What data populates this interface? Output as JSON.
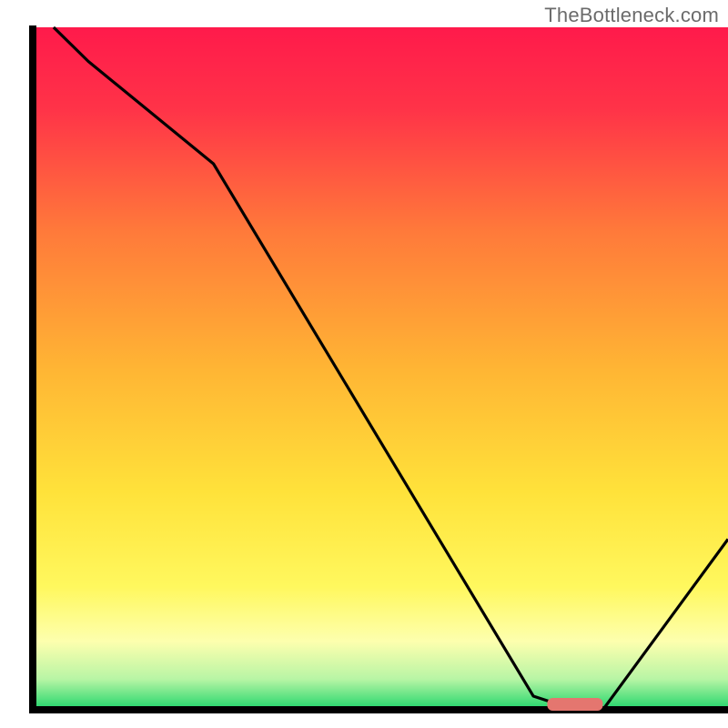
{
  "watermark": "TheBottleneck.com",
  "chart_data": {
    "type": "line",
    "title": "",
    "xlabel": "",
    "ylabel": "",
    "xlim": [
      0,
      100
    ],
    "ylim": [
      0,
      100
    ],
    "series": [
      {
        "name": "bottleneck-curve",
        "x": [
          3,
          8,
          26,
          72,
          78,
          82,
          100
        ],
        "y": [
          100,
          95,
          80,
          2,
          0,
          0,
          25
        ]
      }
    ],
    "marker": {
      "name": "optimal-range",
      "x_start": 74,
      "x_end": 82,
      "y": 0.8,
      "color": "#e4766f"
    },
    "gradient_stops": [
      {
        "offset": 0.0,
        "color": "#ff1a4b"
      },
      {
        "offset": 0.12,
        "color": "#ff3348"
      },
      {
        "offset": 0.3,
        "color": "#ff7a3a"
      },
      {
        "offset": 0.5,
        "color": "#ffb534"
      },
      {
        "offset": 0.68,
        "color": "#ffe23a"
      },
      {
        "offset": 0.82,
        "color": "#fff85e"
      },
      {
        "offset": 0.9,
        "color": "#fdffae"
      },
      {
        "offset": 0.955,
        "color": "#b8f5a5"
      },
      {
        "offset": 1.0,
        "color": "#1fd56a"
      }
    ],
    "axis_color": "#000000",
    "axis_width": 8
  }
}
